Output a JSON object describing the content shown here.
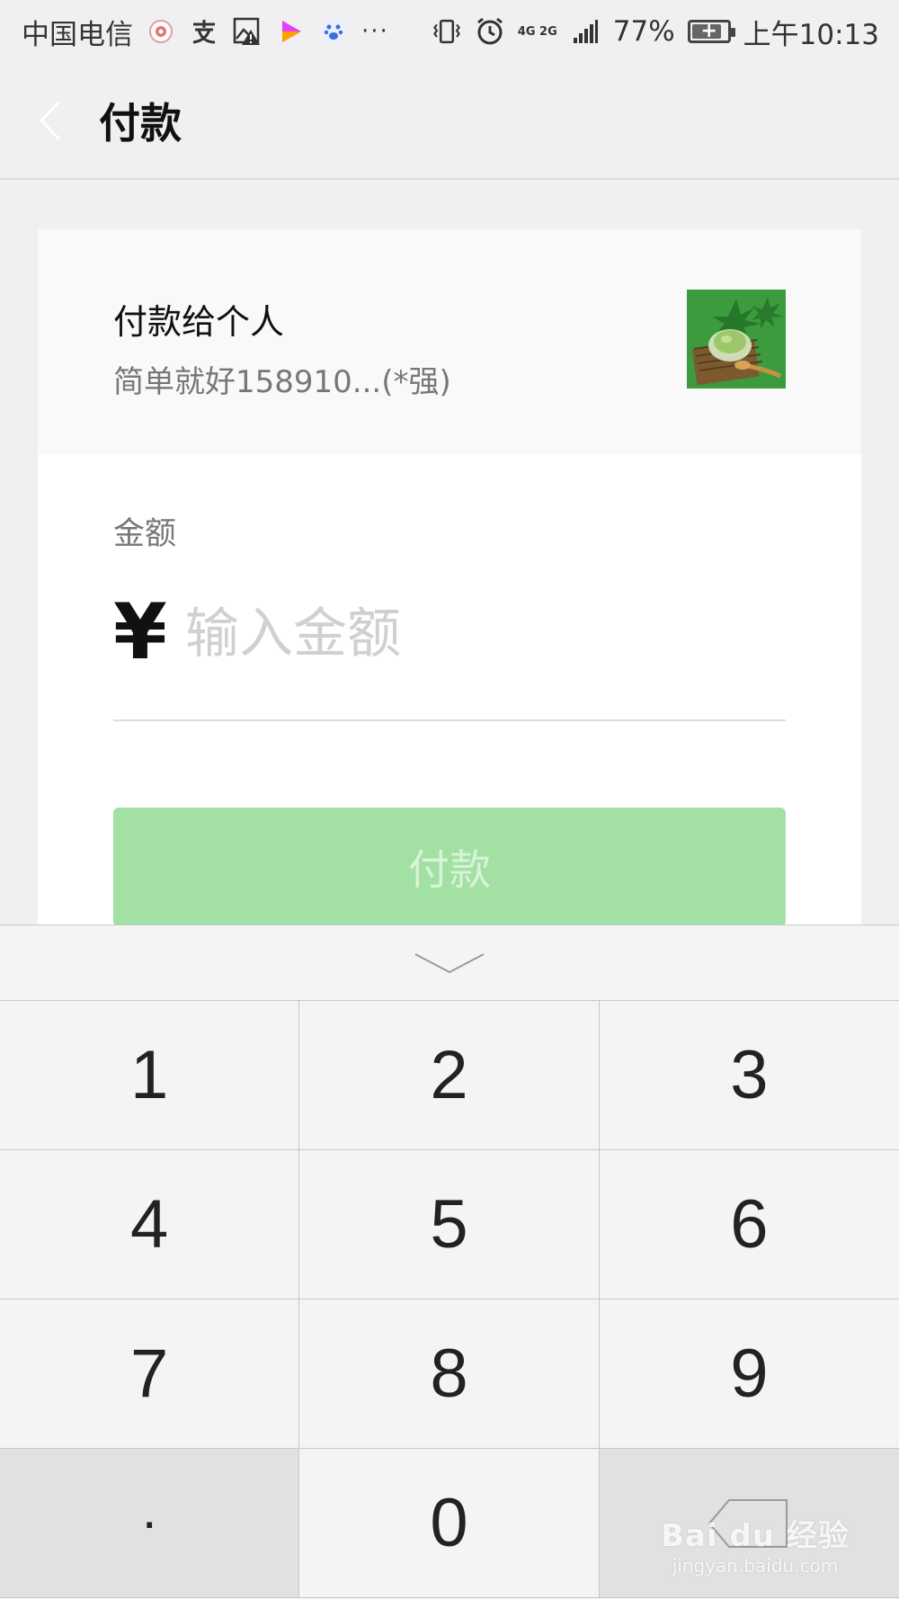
{
  "status_bar": {
    "carrier": "中国电信",
    "network": "4G 2G",
    "battery": "77%",
    "time": "上午10:13",
    "icons": [
      "weibo-icon",
      "alipay-icon",
      "image-alert-icon",
      "video-play-icon",
      "baidu-paw-icon",
      "more-dots-icon",
      "vibrate-icon",
      "alarm-icon",
      "signal-icon",
      "battery-charging-icon"
    ]
  },
  "nav": {
    "title": "付款",
    "back_icon": "chevron-left-icon"
  },
  "payee": {
    "title": "付款给个人",
    "name": "简单就好158910...(*强)",
    "avatar_icon": "avatar-image"
  },
  "amount": {
    "label": "金额",
    "currency": "¥",
    "placeholder": "输入金额",
    "value": ""
  },
  "pay_button": {
    "label": "付款",
    "color": "#a2e0a3"
  },
  "keyboard": {
    "collapse_icon": "chevron-down-icon",
    "keys": [
      "1",
      "2",
      "3",
      "4",
      "5",
      "6",
      "7",
      "8",
      "9",
      ".",
      "0",
      ""
    ],
    "delete_icon": "backspace-icon"
  },
  "watermark": {
    "main": "Bai du 经验",
    "sub": "jingyan.baidu.com"
  },
  "colors": {
    "background": "#f0f0f3",
    "accent_green": "#a2e0a3",
    "keyboard_bg": "#f4f4f4"
  }
}
